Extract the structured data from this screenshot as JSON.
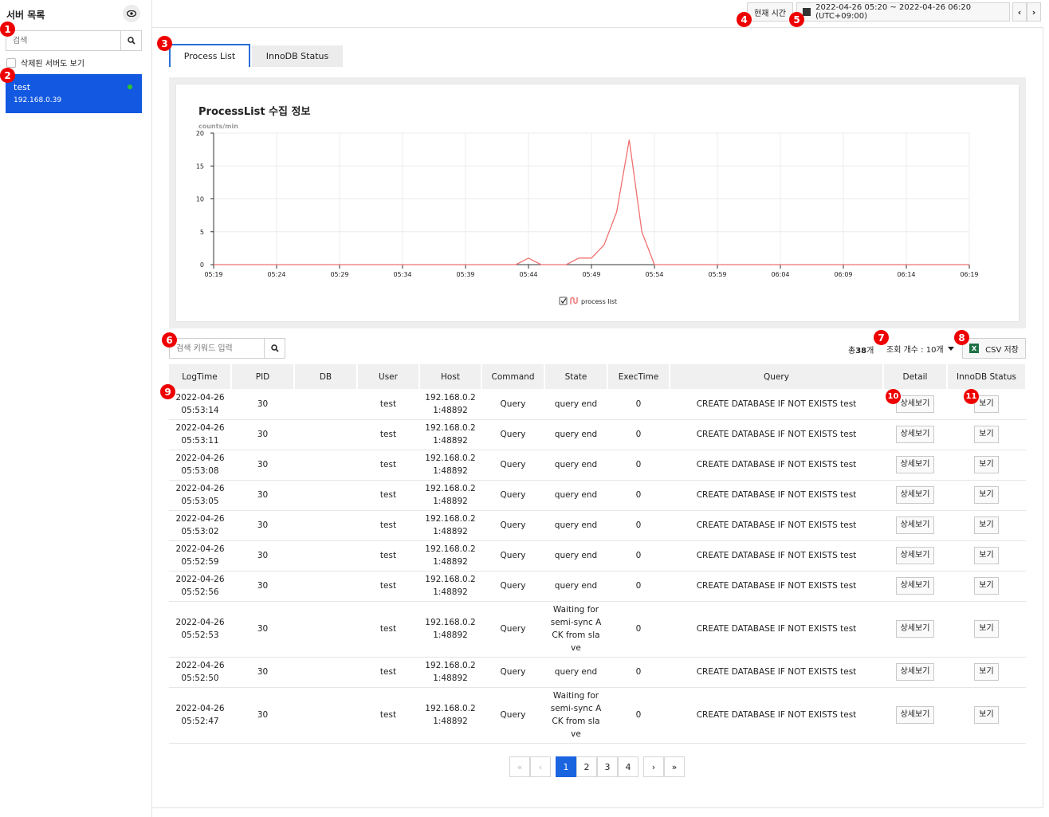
{
  "sidebar": {
    "title": "서버 목록",
    "search_placeholder": "검색",
    "show_deleted_label": "삭제된 서버도 보기",
    "server": {
      "name": "test",
      "ip": "192.168.0.39"
    }
  },
  "topbar": {
    "now_button": "현재 시간",
    "range": "2022-04-26 05:20 ~ 2022-04-26 06:20 (UTC+09:00)",
    "prev": "‹",
    "next": "›"
  },
  "tabs": [
    "Process List",
    "InnoDB Status"
  ],
  "chart_title": "ProcessList 수집 정보",
  "chart_data": {
    "type": "line",
    "ylabel": "counts/min",
    "ylim": [
      0,
      20
    ],
    "yticks": [
      "0",
      "5",
      "10",
      "15",
      "20"
    ],
    "xticks": [
      "05:19",
      "05:24",
      "05:29",
      "05:34",
      "05:39",
      "05:44",
      "05:49",
      "05:54",
      "05:59",
      "06:04",
      "06:09",
      "06:14",
      "06:19"
    ],
    "series": [
      {
        "name": "process list",
        "color": "#f07070",
        "values": [
          0,
          0,
          0,
          0,
          0,
          0,
          0,
          0,
          0,
          0,
          0,
          0,
          0,
          0,
          0,
          0,
          0,
          0,
          0,
          0,
          0,
          0,
          0,
          0,
          0,
          1,
          0,
          0,
          0,
          1,
          1,
          3,
          8,
          19,
          5,
          0,
          0,
          0,
          0,
          0,
          0,
          0,
          0,
          0,
          0,
          0,
          0,
          0,
          0,
          0,
          0,
          0,
          0,
          0,
          0,
          0,
          0,
          0,
          0,
          0,
          0
        ]
      }
    ],
    "legend": "bottom-center"
  },
  "toolbar": {
    "keyword_placeholder": "검색 키워드 입력",
    "total_prefix": "총",
    "total_count": "38",
    "total_suffix": "개",
    "page_size": "조회 개수 : 10개",
    "csv_label": "CSV 저장",
    "excel_letter": "X"
  },
  "table": {
    "headers": [
      "LogTime",
      "PID",
      "DB",
      "User",
      "Host",
      "Command",
      "State",
      "ExecTime",
      "Query",
      "Detail",
      "InnoDB Status"
    ],
    "rows": [
      [
        "2022-04-26\n05:53:14",
        "30",
        "",
        "test",
        "192.168.0.2\n1:48892",
        "Query",
        "query end",
        "0",
        "CREATE DATABASE IF NOT EXISTS test"
      ],
      [
        "2022-04-26\n05:53:11",
        "30",
        "",
        "test",
        "192.168.0.2\n1:48892",
        "Query",
        "query end",
        "0",
        "CREATE DATABASE IF NOT EXISTS test"
      ],
      [
        "2022-04-26\n05:53:08",
        "30",
        "",
        "test",
        "192.168.0.2\n1:48892",
        "Query",
        "query end",
        "0",
        "CREATE DATABASE IF NOT EXISTS test"
      ],
      [
        "2022-04-26\n05:53:05",
        "30",
        "",
        "test",
        "192.168.0.2\n1:48892",
        "Query",
        "query end",
        "0",
        "CREATE DATABASE IF NOT EXISTS test"
      ],
      [
        "2022-04-26\n05:53:02",
        "30",
        "",
        "test",
        "192.168.0.2\n1:48892",
        "Query",
        "query end",
        "0",
        "CREATE DATABASE IF NOT EXISTS test"
      ],
      [
        "2022-04-26\n05:52:59",
        "30",
        "",
        "test",
        "192.168.0.2\n1:48892",
        "Query",
        "query end",
        "0",
        "CREATE DATABASE IF NOT EXISTS test"
      ],
      [
        "2022-04-26\n05:52:56",
        "30",
        "",
        "test",
        "192.168.0.2\n1:48892",
        "Query",
        "query end",
        "0",
        "CREATE DATABASE IF NOT EXISTS test"
      ],
      [
        "2022-04-26\n05:52:53",
        "30",
        "",
        "test",
        "192.168.0.2\n1:48892",
        "Query",
        "Waiting for\nsemi-sync A\nCK from sla\nve",
        "0",
        "CREATE DATABASE IF NOT EXISTS test"
      ],
      [
        "2022-04-26\n05:52:50",
        "30",
        "",
        "test",
        "192.168.0.2\n1:48892",
        "Query",
        "query end",
        "0",
        "CREATE DATABASE IF NOT EXISTS test"
      ],
      [
        "2022-04-26\n05:52:47",
        "30",
        "",
        "test",
        "192.168.0.2\n1:48892",
        "Query",
        "Waiting for\nsemi-sync A\nCK from sla\nve",
        "0",
        "CREATE DATABASE IF NOT EXISTS test"
      ]
    ],
    "detail_label": "상세보기",
    "innodb_label": "보기"
  },
  "pager": {
    "first": "«",
    "prev": "‹",
    "pages": [
      "1",
      "2",
      "3",
      "4"
    ],
    "current": "1",
    "next": "›",
    "last": "»"
  },
  "markers": [
    "1",
    "2",
    "3",
    "4",
    "5",
    "6",
    "7",
    "8",
    "9",
    "10",
    "11"
  ]
}
